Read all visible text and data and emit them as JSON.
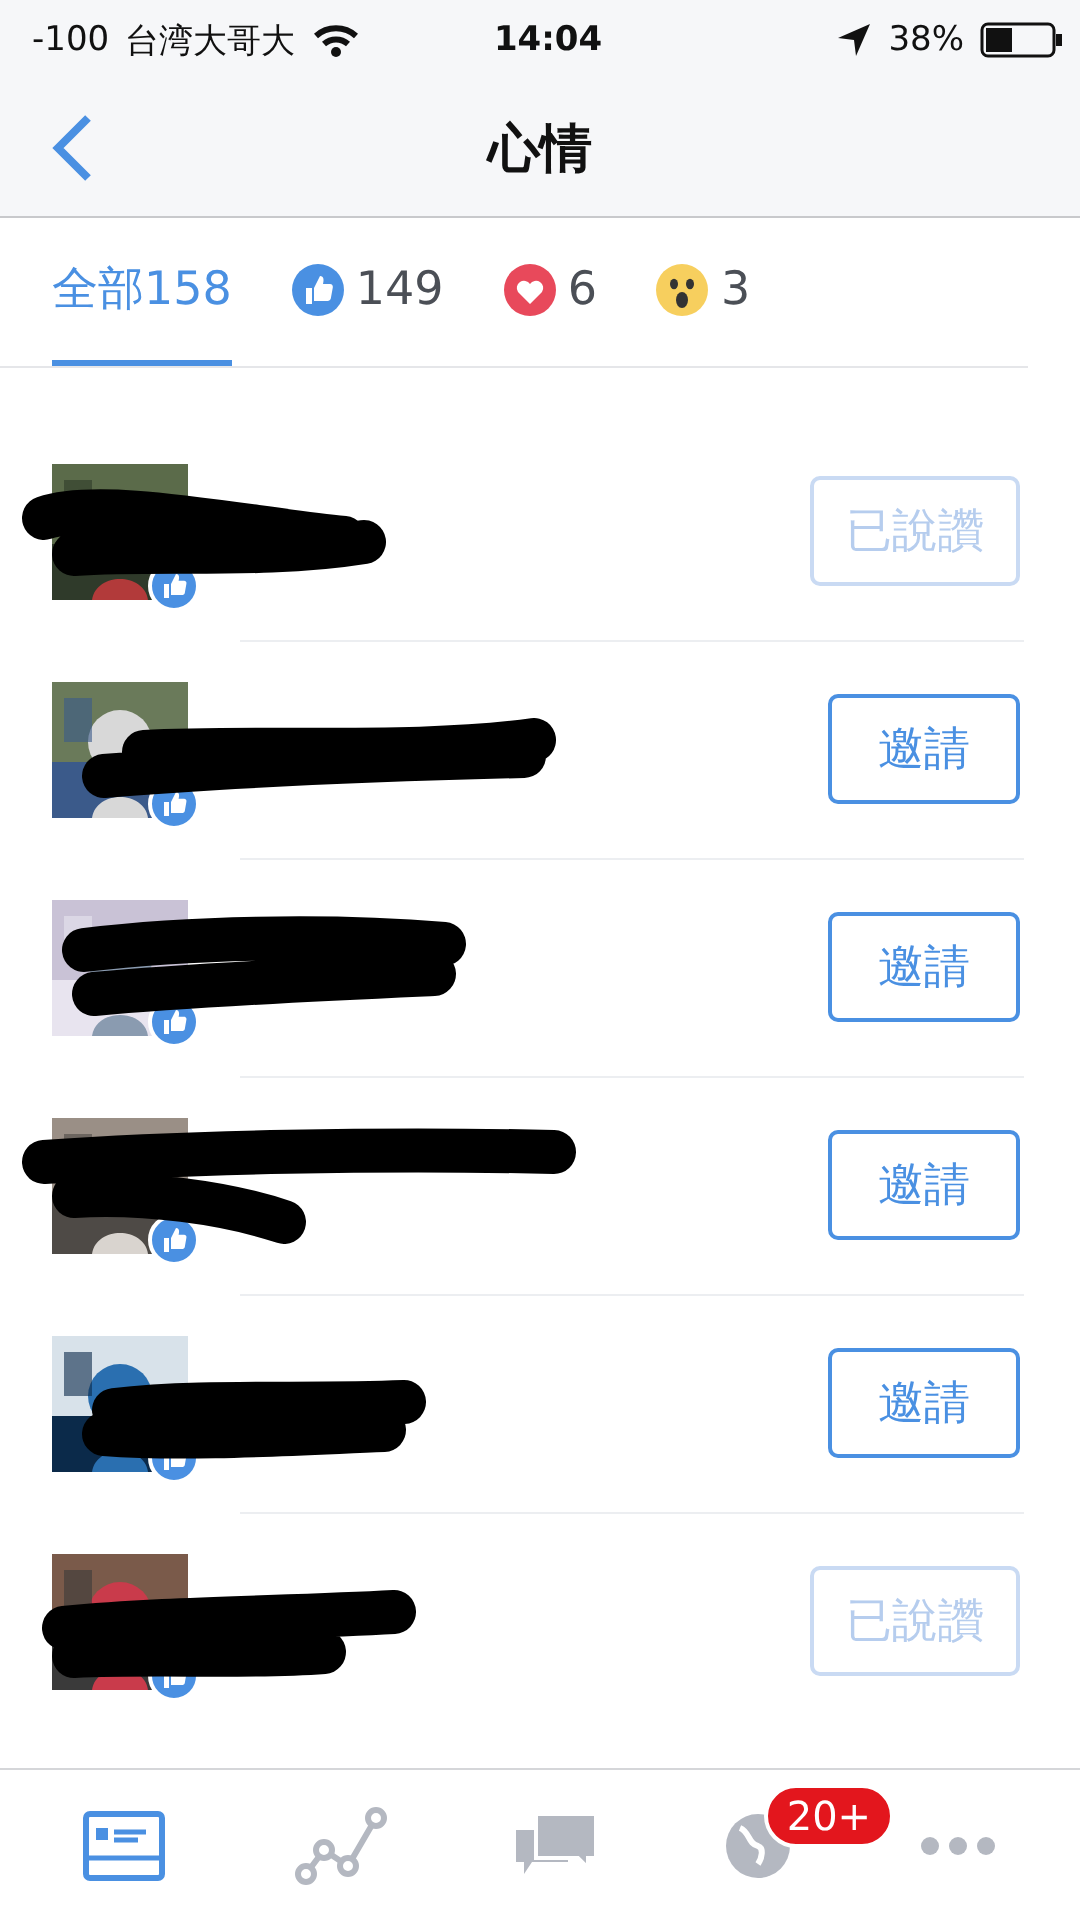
{
  "status_bar": {
    "signal": "-100",
    "carrier": "台湾大哥大",
    "time": "14:04",
    "battery": "38%"
  },
  "nav": {
    "title": "心情"
  },
  "reaction_tabs": [
    {
      "kind": "all",
      "label": "全部158",
      "selected": true
    },
    {
      "kind": "like",
      "label": "149",
      "selected": false
    },
    {
      "kind": "love",
      "label": "6",
      "selected": false
    },
    {
      "kind": "wow",
      "label": "3",
      "selected": false
    }
  ],
  "people": [
    {
      "button": "已說讚",
      "disabled": true
    },
    {
      "button": "邀請",
      "disabled": false
    },
    {
      "button": "邀請",
      "disabled": false
    },
    {
      "button": "邀請",
      "disabled": false
    },
    {
      "button": "邀請",
      "disabled": false
    },
    {
      "button": "已說讚",
      "disabled": true
    }
  ],
  "tab_bar": [
    {
      "kind": "feed",
      "selected": true
    },
    {
      "kind": "insights",
      "selected": false
    },
    {
      "kind": "messages",
      "selected": false
    },
    {
      "kind": "notifications",
      "selected": false,
      "badge": "20+"
    },
    {
      "kind": "more",
      "selected": false
    }
  ]
}
